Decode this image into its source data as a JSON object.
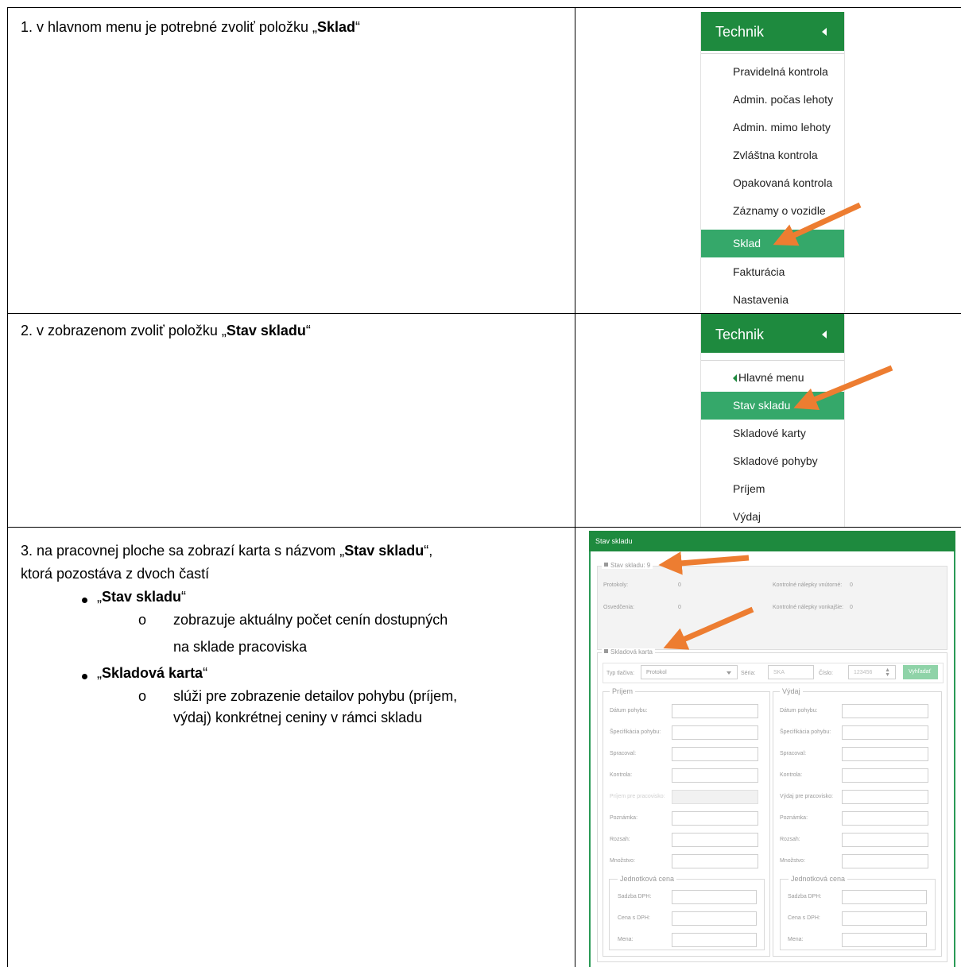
{
  "colors": {
    "menu_header_green": "#1e8a3e",
    "menu_active_green": "#35a86a",
    "arrow_orange": "#ed7d31",
    "button_light_green": "#8fd3a8"
  },
  "rows": [
    {
      "step_prefix": "1. v hlavnom menu je potrebné zvoliť položku „",
      "step_bold": "Sklad",
      "step_suffix": "“"
    },
    {
      "step_prefix": "2. v zobrazenom zvoliť položku „",
      "step_bold": "Stav skladu",
      "step_suffix": "“"
    },
    {
      "step_line1_prefix": "3. na pracovnej ploche sa zobrazí karta s názvom „",
      "step_line1_bold": "Stav skladu",
      "step_line1_suffix": "“,",
      "step_line2": "ktorá pozostáva z dvoch častí",
      "bullets": [
        {
          "open_quote": "„",
          "bold": "Stav skladu",
          "close_quote": "“",
          "sub_mark": "o",
          "sub_line1": "zobrazuje aktuálny počet cenín dostupných",
          "sub_line2": "na sklade pracoviska"
        },
        {
          "open_quote": "„",
          "bold": "Skladová karta",
          "close_quote": "“",
          "sub_mark": "o",
          "sub_line1": "slúži pre zobrazenie detailov pohybu (príjem,",
          "sub_line2": "výdaj) konkrétnej ceniny v rámci skladu"
        }
      ]
    }
  ],
  "menu1": {
    "title": "Technik",
    "items": [
      "Pravidelná kontrola",
      "Admin. počas lehoty",
      "Admin. mimo lehoty",
      "Zvláštna kontrola",
      "Opakovaná kontrola",
      "Záznamy o vozidle",
      "Sklad",
      "Fakturácia",
      "Nastavenia"
    ],
    "active": "Sklad"
  },
  "menu2": {
    "title": "Technik",
    "back_item": "Hlavné menu",
    "items": [
      "Stav skladu",
      "Skladové karty",
      "Skladové pohyby",
      "Príjem",
      "Výdaj"
    ],
    "active": "Stav skladu"
  },
  "app": {
    "title": "Stav skladu",
    "stav_legend": "Stav skladu: 9",
    "stav_rows": [
      {
        "left_label": "Protokoly:",
        "left_value": "0",
        "right_label": "Kontrolné nálepky vnútorné:",
        "right_value": "0"
      },
      {
        "left_label": "Osvedčenia:",
        "left_value": "0",
        "right_label": "Kontrolné nálepky vonkajšie:",
        "right_value": "0"
      }
    ],
    "karta_legend": "Skladová karta",
    "typ_label": "Typ tlačiva:",
    "typ_value": "Protokol",
    "seria_label": "Séria:",
    "seria_placeholder": "SKA",
    "cislo_label": "Číslo:",
    "cislo_placeholder": "123456",
    "search_button": "Vyhľadať",
    "prijem": {
      "legend": "Príjem",
      "fields": [
        "Dátum pohybu:",
        "Špecifikácia pohybu:",
        "Spracoval:",
        "Kontrola:",
        "Príjem pre pracovisko:",
        "Poznámka:",
        "Rozsah:",
        "Množstvo:"
      ]
    },
    "vydaj": {
      "legend": "Výdaj",
      "fields": [
        "Dátum pohybu:",
        "Špecifikácia pohybu:",
        "Spracoval:",
        "Kontrola:",
        "Výdaj pre pracovisko:",
        "Poznámka:",
        "Rozsah:",
        "Množstvo:"
      ]
    },
    "cena": {
      "legend": "Jednotková cena",
      "fields": [
        "Sadzba DPH:",
        "Cena s DPH:",
        "Mena:"
      ]
    }
  }
}
